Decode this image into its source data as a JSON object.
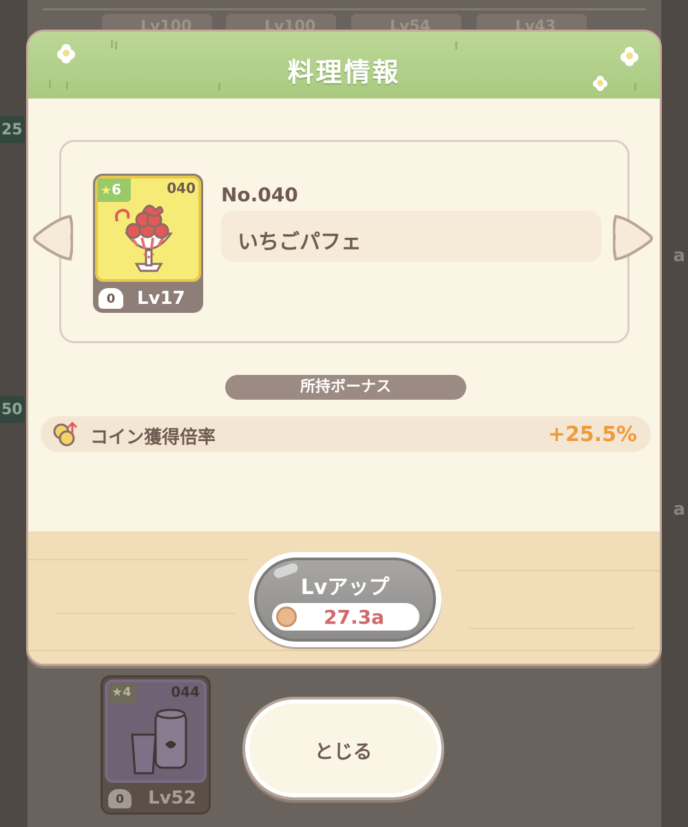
{
  "background": {
    "top_cards": [
      "Lv100",
      "Lv100",
      "Lv54",
      "Lv43"
    ],
    "side_numbers": [
      "25",
      "50"
    ],
    "side_letters": [
      "a",
      "a",
      "a"
    ],
    "bottom_card": {
      "stars": "4",
      "number": "044",
      "chef_count": "0",
      "level": "Lv52"
    }
  },
  "dialog": {
    "title": "料理情報",
    "item": {
      "stars": "6",
      "card_number": "040",
      "chef_count": "0",
      "level": "Lv17",
      "number_label": "No.040",
      "name": "いちごパフェ"
    },
    "bonus_header": "所持ボーナス",
    "bonus": {
      "label": "コイン獲得倍率",
      "value": "+25.5%"
    },
    "lvup_button": {
      "label": "Lvアップ",
      "cost": "27.3a"
    }
  },
  "close_button": {
    "label": "とじる"
  },
  "icons": {
    "prev": "chevron-left-icon",
    "next": "chevron-right-icon",
    "star": "star-icon",
    "chef": "chef-hat-icon",
    "coin_boost": "coin-boost-icon",
    "cost": "chef-coin-icon"
  },
  "colors": {
    "header_green": "#a9ca80",
    "dialog_bg": "#fbf5e6",
    "bonus_value": "#ef9a3d",
    "cost_value": "#d06a6a",
    "card_yellow": "#f7eb78"
  }
}
